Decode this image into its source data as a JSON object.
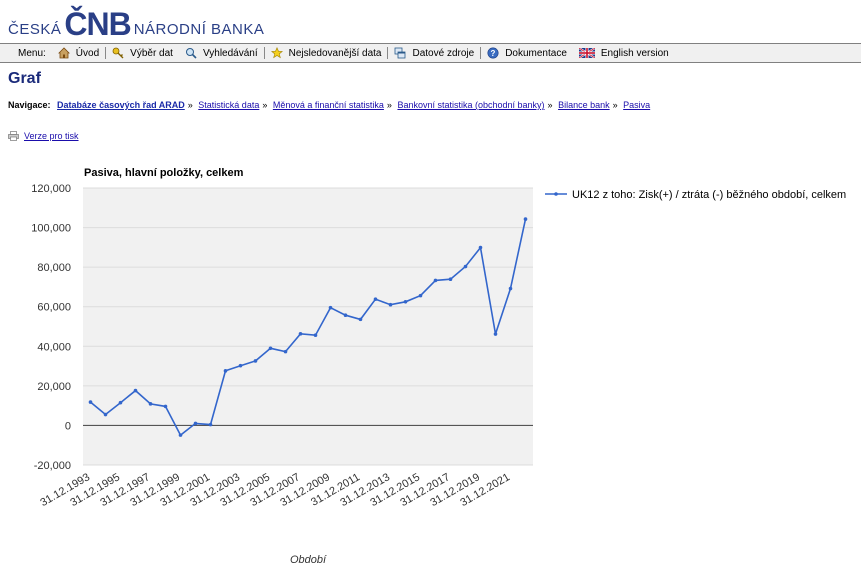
{
  "logo": {
    "left": "ČESKÁ",
    "mid": "ČNB",
    "right": "NÁRODNÍ BANKA"
  },
  "menu": {
    "caption": "Menu:",
    "items": [
      {
        "label": "Úvod",
        "icon": "home-icon"
      },
      {
        "label": "Výběr dat",
        "icon": "key-icon"
      },
      {
        "label": "Vyhledávání",
        "icon": "search-icon"
      },
      {
        "label": "Nejsledovanější data",
        "icon": "star-icon"
      },
      {
        "label": "Datové zdroje",
        "icon": "windows-icon"
      },
      {
        "label": "Dokumentace",
        "icon": "help-icon"
      },
      {
        "label": "English version",
        "icon": "uk-flag-icon"
      }
    ]
  },
  "page": {
    "title": "Graf"
  },
  "breadcrumb": {
    "caption": "Navigace:",
    "items": [
      "Databáze časových řad ARAD",
      "Statistická data",
      "Měnová a finanční statistika",
      "Bankovní statistika (obchodní banky)",
      "Bilance bank",
      "Pasiva"
    ]
  },
  "print": {
    "label": "Verze pro tisk"
  },
  "chart_data": {
    "type": "line",
    "title": "Pasiva, hlavní položky, celkem",
    "xlabel": "Období",
    "ylabel": "",
    "ylim": [
      -20000,
      120000
    ],
    "yticks": [
      "120,000",
      "100,000",
      "80,000",
      "60,000",
      "40,000",
      "20,000",
      "0",
      "-20,000"
    ],
    "x": [
      "31.12.1993",
      "31.12.1994",
      "31.12.1995",
      "31.12.1996",
      "31.12.1997",
      "31.12.1998",
      "31.12.1999",
      "31.12.2000",
      "31.12.2001",
      "31.12.2002",
      "31.12.2003",
      "31.12.2004",
      "31.12.2005",
      "31.12.2006",
      "31.12.2007",
      "31.12.2008",
      "31.12.2009",
      "31.12.2010",
      "31.12.2011",
      "31.12.2012",
      "31.12.2013",
      "31.12.2014",
      "31.12.2015",
      "31.12.2016",
      "31.12.2017",
      "31.12.2018",
      "31.12.2019",
      "31.12.2020",
      "31.12.2021",
      "31.12.2022"
    ],
    "xtick_labels": [
      "31.12.1993",
      "31.12.1995",
      "31.12.1997",
      "31.12.1999",
      "31.12.2001",
      "31.12.2003",
      "31.12.2005",
      "31.12.2007",
      "31.12.2009",
      "31.12.2011",
      "31.12.2013",
      "31.12.2015",
      "31.12.2017",
      "31.12.2019",
      "31.12.2021"
    ],
    "series": [
      {
        "name": "UK12 z toho: Zisk(+) / ztráta (-) běžného období, celkem",
        "values": [
          11800,
          5500,
          11500,
          17600,
          10900,
          9600,
          -4900,
          1000,
          400,
          27600,
          30200,
          32600,
          39000,
          37300,
          46300,
          45600,
          59500,
          55700,
          53600,
          63800,
          61000,
          62500,
          65600,
          73300,
          73900,
          80300,
          89900,
          46200,
          69200,
          104300
        ]
      }
    ],
    "colors": {
      "line": "#3366cc",
      "plot_bg": "#f1f1f1",
      "grid": "#dcdcdc",
      "zero_line": "#555555"
    },
    "grid": true,
    "legend_position": "right"
  }
}
